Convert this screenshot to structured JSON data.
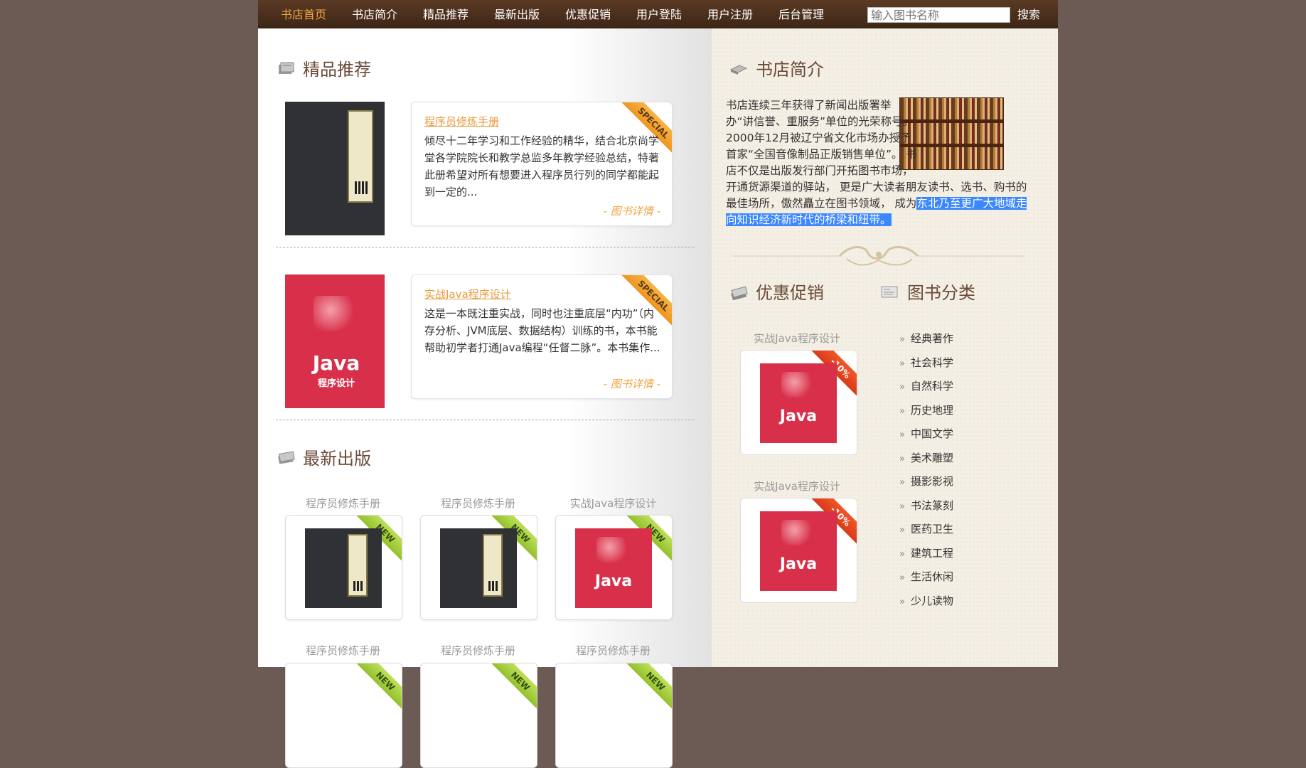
{
  "nav": {
    "items": [
      "书店首页",
      "书店简介",
      "精品推荐",
      "最新出版",
      "优惠促销",
      "用户登陆",
      "用户注册",
      "后台管理"
    ],
    "active_index": 0,
    "search_placeholder": "输入图书名称",
    "search_button": "搜索"
  },
  "recommend": {
    "title": "精品推荐",
    "ribbon": "SPECIAL",
    "link": "- 图书详情 -",
    "books": [
      {
        "title": "程序员修炼手册",
        "desc": "倾尽十二年学习和工作经验的精华，结合北京尚学堂各学院院长和教学总监多年教学经验总结，特著此册希望对所有想要进入程序员行列的同学都能起到一定的...",
        "cover": "dark"
      },
      {
        "title": "实战Java程序设计",
        "desc": "这是一本既注重实战，同时也注重底层“内功”（内存分析、JVM底层、数据结构）训练的书，本书能帮助初学者打通Java编程“任督二脉”。本书集作...",
        "cover": "red"
      }
    ]
  },
  "latest": {
    "title": "最新出版",
    "ribbon": "NEW",
    "row1": [
      {
        "title": "程序员修炼手册",
        "cover": "dark"
      },
      {
        "title": "程序员修炼手册",
        "cover": "dark"
      },
      {
        "title": "实战Java程序设计",
        "cover": "red"
      }
    ],
    "row2": [
      {
        "title": "程序员修炼手册"
      },
      {
        "title": "程序员修炼手册"
      },
      {
        "title": "程序员修炼手册"
      }
    ]
  },
  "intro": {
    "title": "书店简介",
    "text": "书店连续三年获得了新闻出版署举办“讲信誉、重服务”单位的光荣称号。2000年12月被辽宁省文化市场办授予首家“全国音像制品正版销售单位”。 书店不仅是出版发行部门开拓图书市场，开通货源渠道的驿站， 更是广大读者朋友读书、选书、购书的最佳场所，傲然矗立在图书领域， 成为",
    "highlight": "东北乃至更广大地域走向知识经济新时代的桥梁和纽带。"
  },
  "promo": {
    "title": "优惠促销",
    "ribbon": "-10%",
    "items": [
      {
        "title": "实战Java程序设计"
      },
      {
        "title": "实战Java程序设计"
      }
    ]
  },
  "categories": {
    "title": "图书分类",
    "items": [
      "经典著作",
      "社会科学",
      "自然科学",
      "历史地理",
      "中国文学",
      "美术雕塑",
      "摄影影视",
      "书法篆刻",
      "医药卫生",
      "建筑工程",
      "生活休闲",
      "少儿读物"
    ]
  },
  "java_cover_text": {
    "big": "Java",
    "small": "程序设计",
    "prefix": "实战"
  }
}
